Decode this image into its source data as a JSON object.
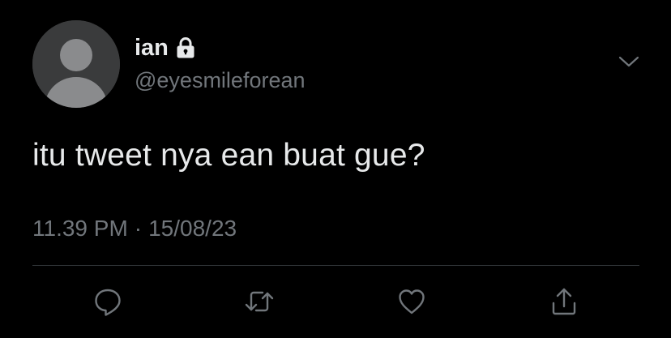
{
  "tweet": {
    "display_name": "ian",
    "handle": "@eyesmileforean",
    "protected": true,
    "text": "itu tweet nya ean buat gue?",
    "time": "11.39 PM",
    "separator": "·",
    "date": "15/08/23"
  },
  "icons": {
    "lock": "lock-icon",
    "caret": "chevron-down-icon",
    "reply": "reply-icon",
    "retweet": "retweet-icon",
    "like": "heart-icon",
    "share": "share-icon"
  },
  "colors": {
    "background": "#000000",
    "primary_text": "#e7e9ea",
    "secondary_text": "#71767b",
    "divider": "#2f3336",
    "avatar_bg": "#3a3b3c",
    "avatar_fg": "#7b7c7e"
  }
}
